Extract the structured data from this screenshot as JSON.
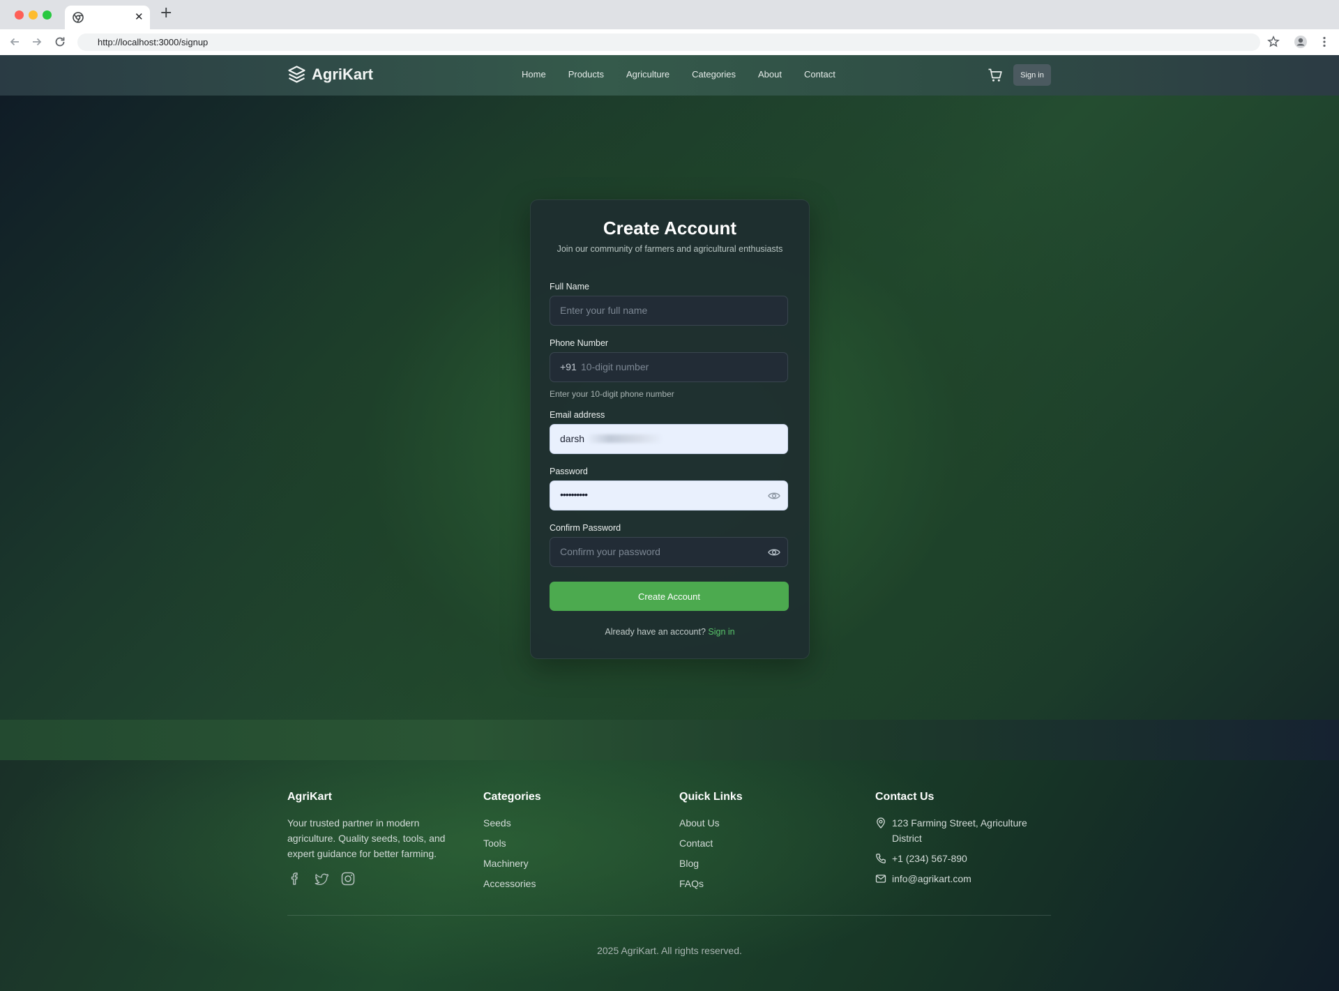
{
  "browser": {
    "url": "http://localhost:3000/signup",
    "new_tab_symbol": "+",
    "close_symbol": "✕"
  },
  "header": {
    "logo_text": "AgriKart",
    "nav": [
      "Home",
      "Products",
      "Agriculture",
      "Categories",
      "About",
      "Contact"
    ],
    "signin_label": "Sign in"
  },
  "form": {
    "title": "Create Account",
    "subtitle": "Join our community of farmers and agricultural enthusiasts",
    "full_name": {
      "label": "Full Name",
      "placeholder": "Enter your full name"
    },
    "phone": {
      "label": "Phone Number",
      "prefix": "+91",
      "placeholder": "10-digit number",
      "hint": "Enter your 10-digit phone number"
    },
    "email": {
      "label": "Email address",
      "value": "darsh"
    },
    "password": {
      "label": "Password",
      "value": "••••••••••"
    },
    "confirm_password": {
      "label": "Confirm Password",
      "placeholder": "Confirm your password"
    },
    "submit_label": "Create Account",
    "signin_prompt": "Already have an account?",
    "signin_link": "Sign in"
  },
  "footer": {
    "brand": {
      "title": "AgriKart",
      "description": "Your trusted partner in modern agriculture. Quality seeds, tools, and expert guidance for better farming."
    },
    "categories": {
      "title": "Categories",
      "items": [
        "Seeds",
        "Tools",
        "Machinery",
        "Accessories"
      ]
    },
    "quick_links": {
      "title": "Quick Links",
      "items": [
        "About Us",
        "Contact",
        "Blog",
        "FAQs"
      ]
    },
    "contact": {
      "title": "Contact Us",
      "address": "123 Farming Street, Agriculture District",
      "phone": "+1 (234) 567-890",
      "email": "info@agrikart.com"
    },
    "copyright": "2025 AgriKart. All rights reserved."
  },
  "colors": {
    "accent_green": "#4caa4f",
    "link_green": "#58c46a",
    "filled_input_bg": "#e9f0fd"
  },
  "icons": [
    "chrome-icon",
    "back-icon",
    "forward-icon",
    "reload-icon",
    "star-icon",
    "profile-icon",
    "menu-icon",
    "logo-icon",
    "cart-icon",
    "eye-icon",
    "facebook-icon",
    "twitter-icon",
    "instagram-icon",
    "location-icon",
    "phone-icon",
    "mail-icon"
  ]
}
